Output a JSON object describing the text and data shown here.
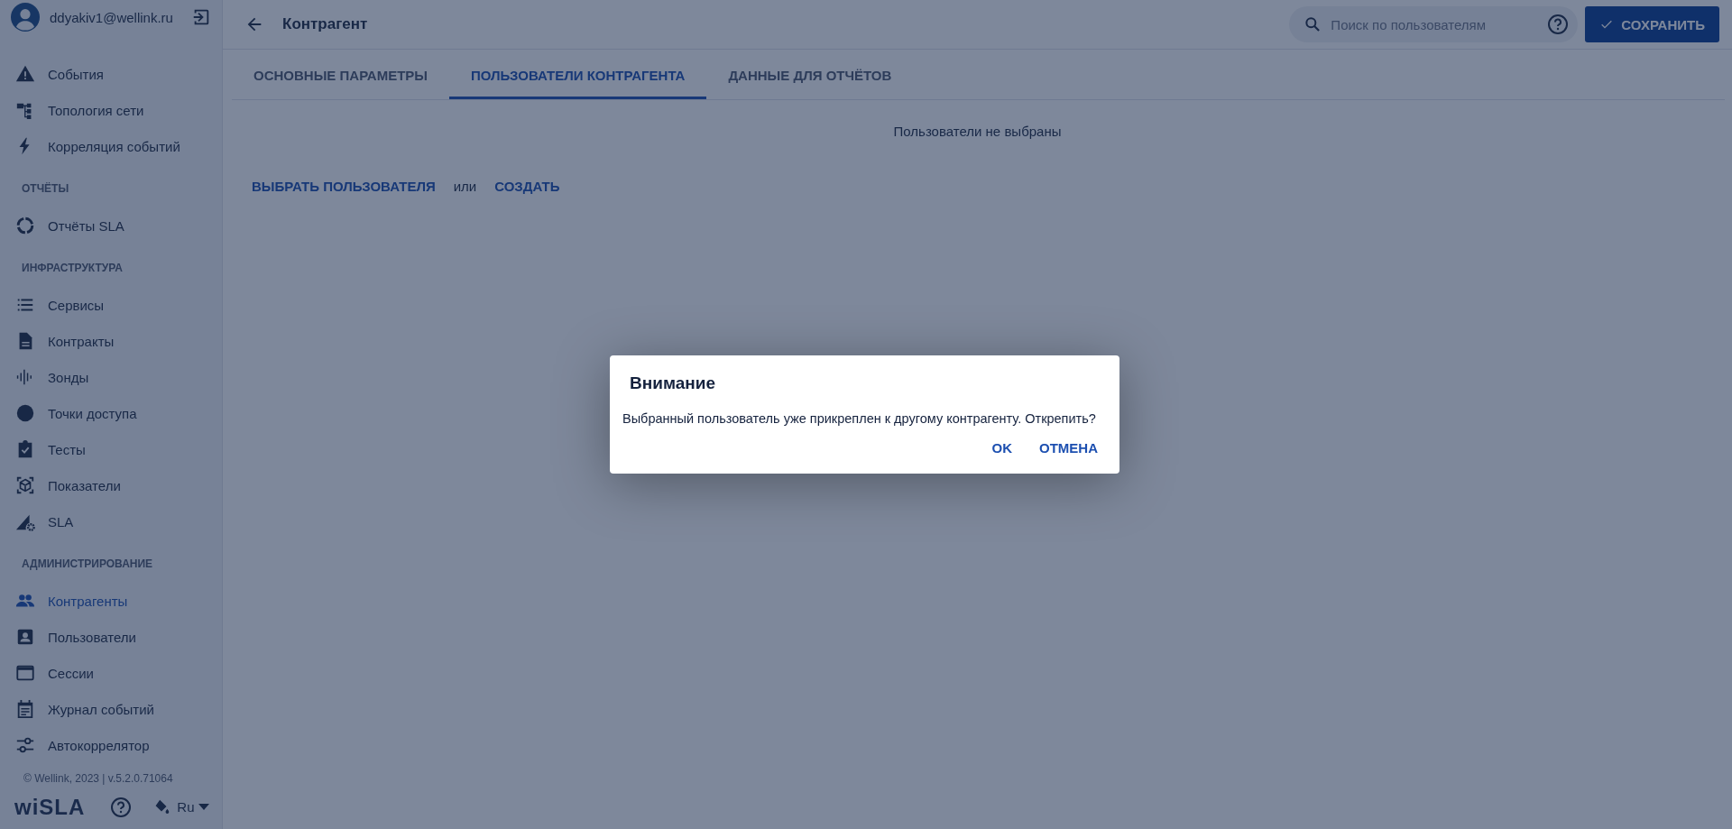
{
  "user": {
    "email": "ddyakiv1@wellink.ru"
  },
  "sidebar": {
    "sections": [
      {
        "items": [
          {
            "label": "События",
            "selected": false
          },
          {
            "label": "Топология сети",
            "selected": false
          },
          {
            "label": "Корреляция событий",
            "selected": false
          }
        ]
      },
      {
        "title": "ОТЧЁТЫ",
        "items": [
          {
            "label": "Отчёты SLA",
            "selected": false
          }
        ]
      },
      {
        "title": "ИНФРАСТРУКТУРА",
        "items": [
          {
            "label": "Сервисы",
            "selected": false
          },
          {
            "label": "Контракты",
            "selected": false
          },
          {
            "label": "Зонды",
            "selected": false
          },
          {
            "label": "Точки доступа",
            "selected": false
          },
          {
            "label": "Тесты",
            "selected": false
          },
          {
            "label": "Показатели",
            "selected": false
          },
          {
            "label": "SLA",
            "selected": false
          }
        ]
      },
      {
        "title": "АДМИНИСТРИРОВАНИЕ",
        "items": [
          {
            "label": "Контрагенты",
            "selected": true
          },
          {
            "label": "Пользователи",
            "selected": false
          },
          {
            "label": "Сессии",
            "selected": false
          },
          {
            "label": "Журнал событий",
            "selected": false
          },
          {
            "label": "Автокоррелятор",
            "selected": false
          }
        ]
      }
    ],
    "copyright": "© Wellink, 2023 | v.5.2.0.71064",
    "logo": "wiSLA",
    "language": "Ru"
  },
  "header": {
    "title": "Контрагент",
    "search": {
      "placeholder": "Поиск по пользователям"
    },
    "save_button": "СОХРАНИТЬ"
  },
  "tabs": [
    {
      "label": "ОСНОВНЫЕ ПАРАМЕТРЫ",
      "selected": false
    },
    {
      "label": "ПОЛЬЗОВАТЕЛИ КОНТРАГЕНТА",
      "selected": true
    },
    {
      "label": "ДАННЫЕ ДЛЯ ОТЧЁТОВ",
      "selected": false
    }
  ],
  "content": {
    "empty_message": "Пользователи не выбраны",
    "select_link": "ВЫБРАТЬ ПОЛЬЗОВАТЕЛЯ",
    "or_text": "или",
    "create_link": "СОЗДАТЬ"
  },
  "dialog": {
    "title": "Внимание",
    "message": "Выбранный пользователь уже прикреплен к другому контрагенту. Открепить?",
    "buttons": [
      "OK",
      "ОТМЕНА"
    ]
  }
}
